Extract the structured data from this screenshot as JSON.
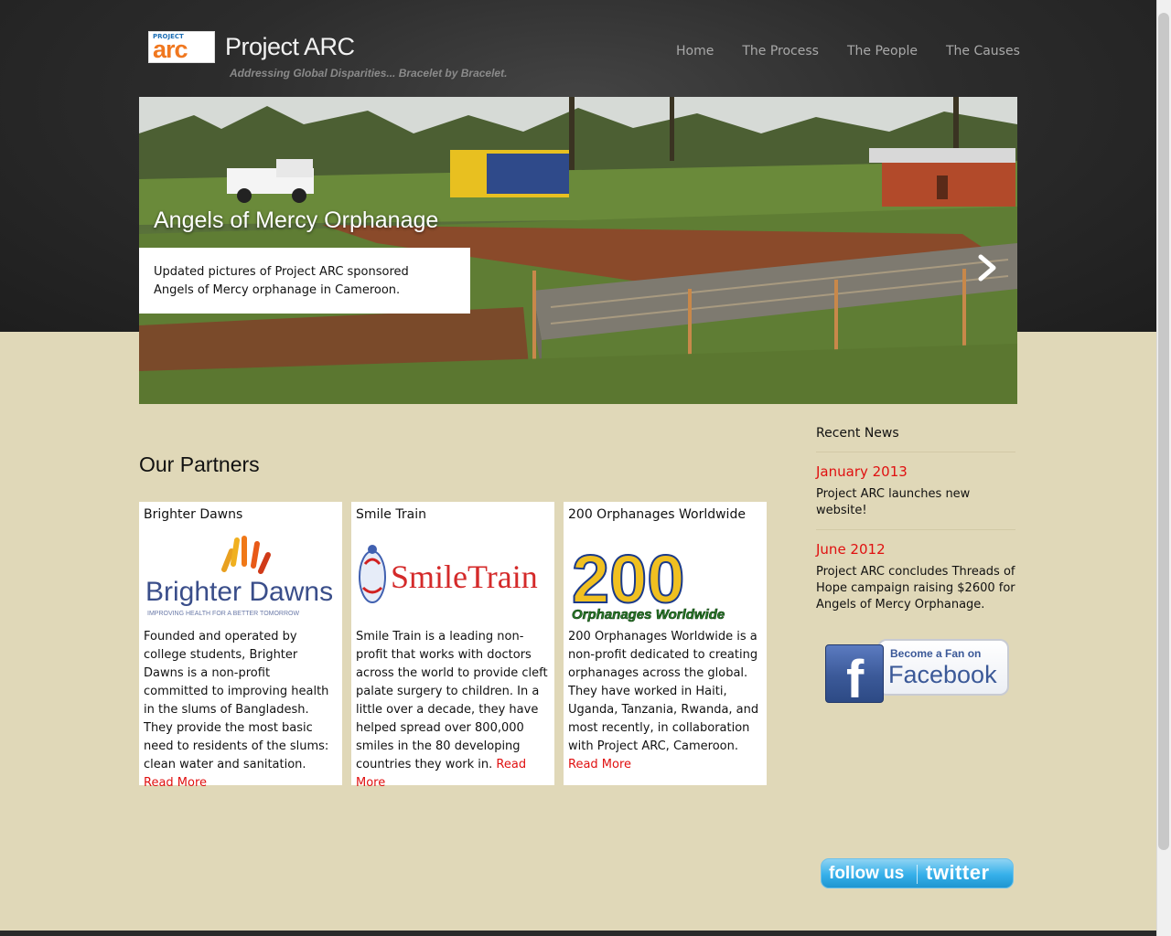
{
  "header": {
    "logo_small": "PROJECT",
    "logo_text": "arc",
    "site_title": "Project ARC",
    "tagline": "Addressing Global Disparities... Bracelet by Bracelet."
  },
  "nav": {
    "items": [
      {
        "label": "Home"
      },
      {
        "label": "The Process"
      },
      {
        "label": "The People"
      },
      {
        "label": "The Causes"
      }
    ]
  },
  "slider": {
    "title": "Angels of Mercy Orphanage",
    "caption_line1": "Updated pictures of Project ARC sponsored",
    "caption_line2": "Angels of Mercy orphanage in Cameroon."
  },
  "partners": {
    "heading": "Our Partners",
    "read_more_label": "Read More",
    "cards": [
      {
        "title": "Brighter Dawns",
        "logo_name": "Brighter Dawns",
        "logo_tagline": "IMPROVING HEALTH FOR A BETTER TOMORROW",
        "description": "Founded and operated by college students, Brighter Dawns is a non-profit committed to improving health in the slums of Bangladesh. They provide the most basic need to residents of the slums: clean water and sanitation."
      },
      {
        "title": "Smile Train",
        "logo_name": "SmileTrain",
        "description": "Smile Train is a leading non-profit that works with doctors across the world to provide cleft palate surgery to children. In a little over a decade, they have helped spread over 800,000 smiles in the 80 developing countries they work in."
      },
      {
        "title": "200 Orphanages Worldwide",
        "logo_number": "200",
        "logo_name": "Orphanages Worldwide",
        "description": "200 Orphanages Worldwide is a non-profit dedicated to creating orphanages across the global. They have worked in Haiti, Uganda, Tanzania, Rwanda, and most recently, in collaboration with Project ARC, Cameroon."
      }
    ]
  },
  "sidebar": {
    "heading": "Recent News",
    "news": [
      {
        "date": "January 2013",
        "text": "Project ARC launches new website!"
      },
      {
        "date": "June 2012",
        "text": "Project ARC concludes Threads of Hope campaign raising $2600 for Angels of Mercy Orphanage."
      }
    ],
    "facebook_line1": "Become a Fan on",
    "facebook_line2": "Facebook",
    "facebook_letter": "f",
    "twitter_follow": "follow us",
    "twitter_name": "twitter"
  },
  "colors": {
    "accent_red": "#e01010",
    "page_background": "#e0d8b8",
    "header_dark": "#2c2c2c",
    "facebook_blue": "#3b5998",
    "twitter_blue": "#36b0ea"
  }
}
